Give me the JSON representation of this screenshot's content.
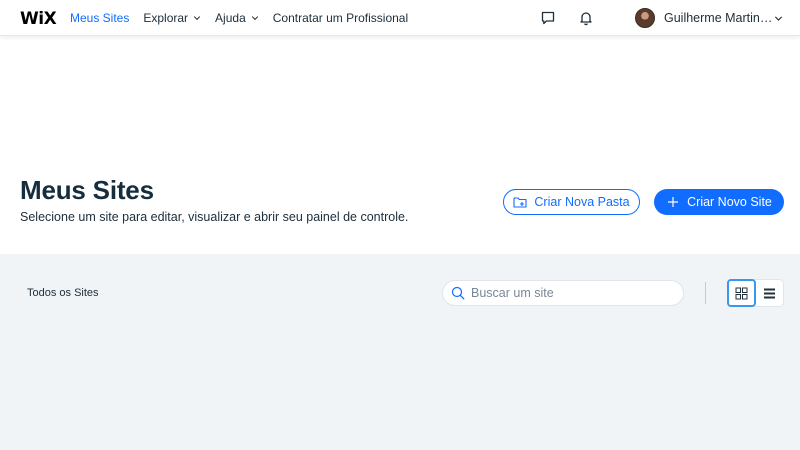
{
  "brand": {
    "logo_text": "WiX"
  },
  "nav": {
    "items": [
      {
        "label": "Meus Sites",
        "active": true,
        "has_dropdown": false
      },
      {
        "label": "Explorar",
        "active": false,
        "has_dropdown": true
      },
      {
        "label": "Ajuda",
        "active": false,
        "has_dropdown": true
      },
      {
        "label": "Contratar um Profissional",
        "active": false,
        "has_dropdown": false
      }
    ]
  },
  "user": {
    "name": "Guilherme Martin…"
  },
  "header": {
    "title": "Meus Sites",
    "subtitle": "Selecione um site para editar, visualizar e abrir seu painel de controle.",
    "new_folder_label": "Criar Nova Pasta",
    "new_site_label": "Criar Novo Site"
  },
  "panel": {
    "filter_label": "Todos os Sites",
    "search_placeholder": "Buscar um site",
    "search_value": "",
    "view_mode": "grid"
  },
  "icons": {
    "chat": "chat-bubble-icon",
    "notifications": "bell-icon",
    "folder": "folder-plus-icon",
    "plus": "plus-icon",
    "search": "search-icon",
    "grid_view": "grid-view-icon",
    "list_view": "list-view-icon"
  },
  "colors": {
    "accent": "#116dff",
    "panel_bg": "#f0f4f7",
    "title": "#162d3d",
    "text": "#20303c"
  }
}
